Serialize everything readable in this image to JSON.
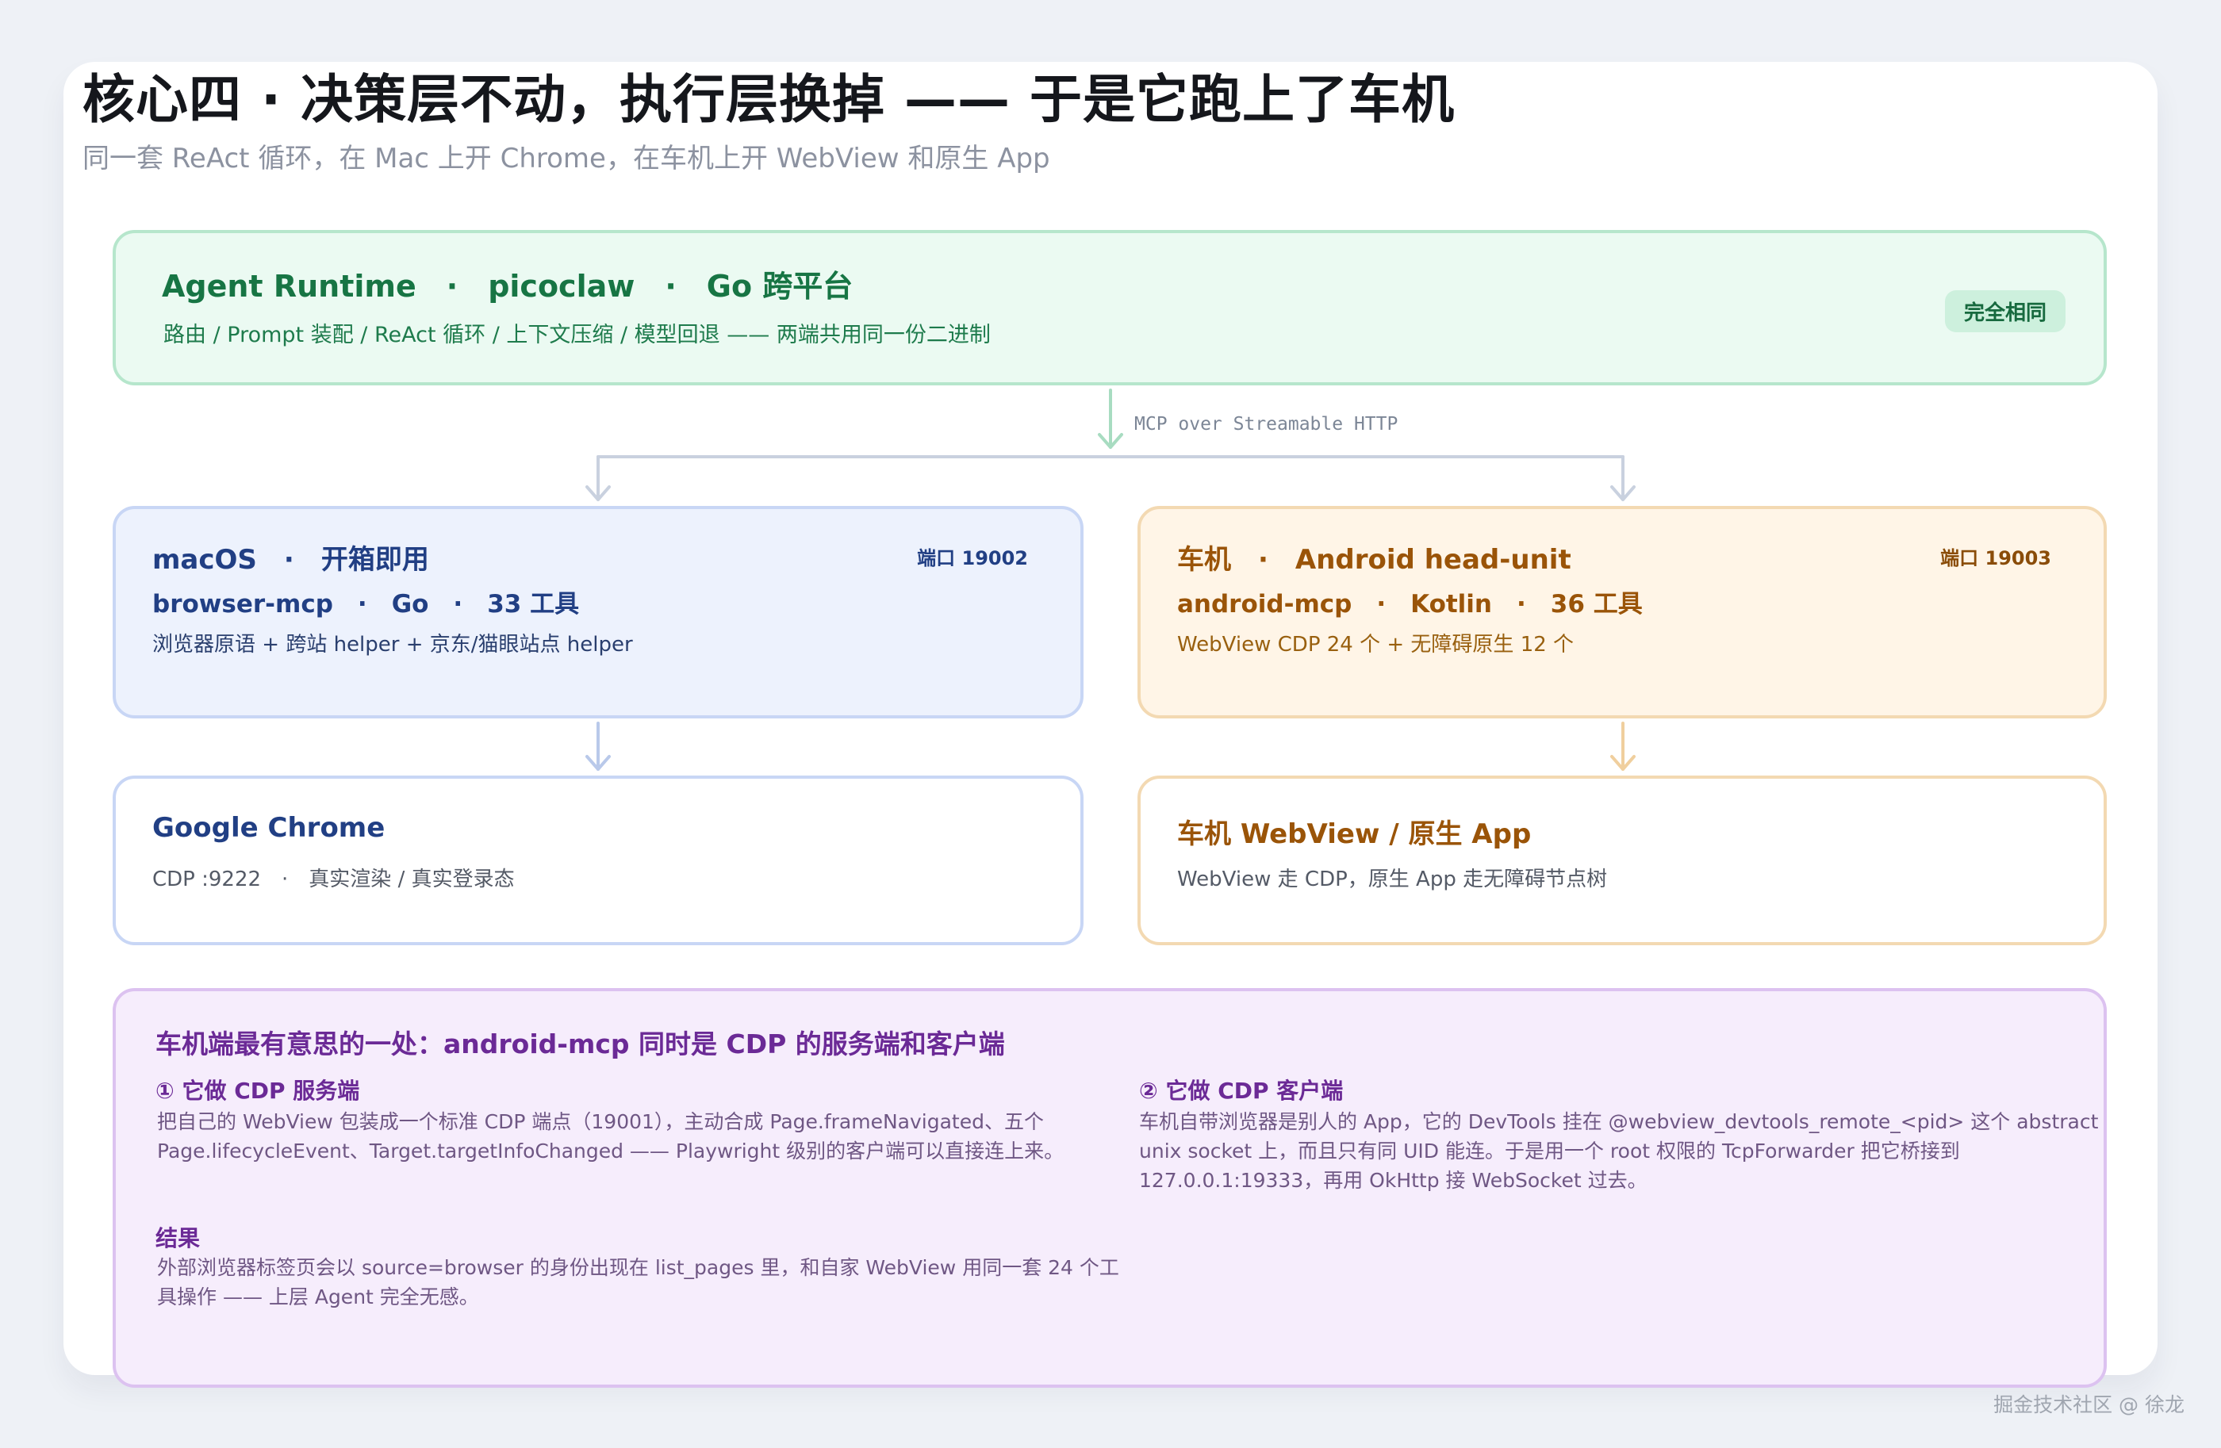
{
  "title": "核心四 · 决策层不动，执行层换掉 —— 于是它跑上了车机",
  "subtitle": "同一套 ReAct 循环，在 Mac 上开 Chrome，在车机上开 WebView 和原生 App",
  "colors": {
    "green_border": "#b6e6cc",
    "green_text": "#177544",
    "blue_border": "#c8d6f5",
    "blue_text": "#213f84",
    "orange_border": "#f3d9b2",
    "orange_text": "#9a5408",
    "purple_border": "#dcc2f0",
    "purple_text": "#6b2a96"
  },
  "runtime": {
    "title": "Agent Runtime　·　picoclaw　·　Go 跨平台",
    "subtitle": "路由 / Prompt 装配 / ReAct 循环 / 上下文压缩 / 模型回退 —— 两端共用同一份二进制",
    "tag": "完全相同"
  },
  "edge_label": "MCP over Streamable HTTP",
  "mac": {
    "title": "macOS　·　开箱即用",
    "port": "端口 19002",
    "line1": "browser-mcp　·　Go　·　33 工具",
    "line2": "浏览器原语 + 跨站 helper + 京东/猫眼站点 helper"
  },
  "car": {
    "title": "车机　·　Android head-unit",
    "port": "端口 19003",
    "line1": "android-mcp　·　Kotlin　·　36 工具",
    "line2": "WebView CDP 24 个 + 无障碍原生 12 个"
  },
  "chrome": {
    "title": "Google Chrome",
    "subtitle": "CDP :9222　·　真实渲染 / 真实登录态"
  },
  "webview": {
    "title": "车机 WebView / 原生 App",
    "subtitle": "WebView 走 CDP，原生 App 走无障碍节点树"
  },
  "note": {
    "title": "车机端最有意思的一处：android-mcp 同时是 CDP 的服务端和客户端",
    "server": {
      "heading": "① 它做 CDP 服务端",
      "lines": [
        "把自己的 WebView 包装成一个标准 CDP 端点（19001），主动合成 Page.frameNavigated、五个",
        "Page.lifecycleEvent、Target.targetInfoChanged —— Playwright 级别的客户端可以直接连上来。"
      ]
    },
    "client": {
      "heading": "② 它做 CDP 客户端",
      "lines": [
        "车机自带浏览器是别人的 App，它的 DevTools 挂在 @webview_devtools_remote_<pid> 这个 abstract",
        "unix socket 上，而且只有同 UID 能连。于是用一个 root 权限的 TcpForwarder 把它桥接到",
        "127.0.0.1:19333，再用 OkHttp 接 WebSocket 过去。"
      ]
    },
    "result": {
      "heading": "结果",
      "lines": [
        "外部浏览器标签页会以 source=browser 的身份出现在 list_pages 里，和自家 WebView 用同一套 24 个工",
        "具操作 —— 上层 Agent 完全无感。"
      ]
    }
  },
  "watermark": "掘金技术社区 @ 徐龙"
}
